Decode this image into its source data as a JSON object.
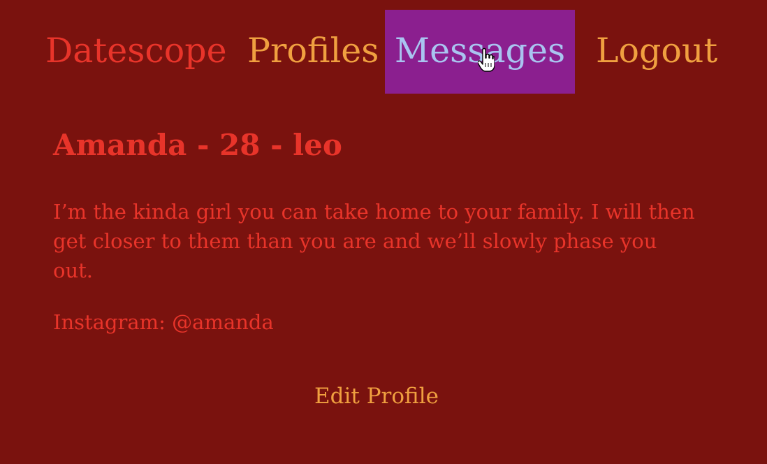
{
  "nav": {
    "brand": "Datescope",
    "items": [
      {
        "label": "Profiles"
      },
      {
        "label": "Messages",
        "active": true
      },
      {
        "label": "Logout"
      }
    ]
  },
  "profile": {
    "name_line": "Amanda - 28 - leo",
    "bio": "I’m the kinda girl you can take home to your family. I will then get closer to them than you are and we’ll slowly phase you out.",
    "instagram": "Instagram: @amanda"
  },
  "actions": {
    "edit_profile": "Edit Profile"
  },
  "colors": {
    "background": "#7a120e",
    "brand_red": "#e8342a",
    "nav_orange": "#f0a040",
    "active_bg": "#8b1f8f",
    "active_text": "#a9c4f0"
  }
}
